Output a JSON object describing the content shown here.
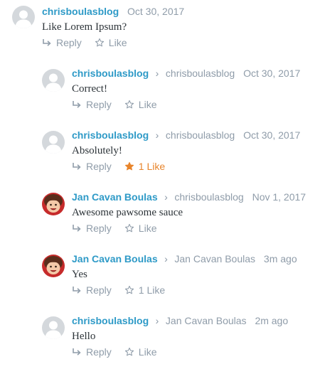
{
  "colors": {
    "author": "#2e9ac7",
    "meta": "#8f9ca9",
    "body_text": "#2c3338",
    "liked": "#e8852c",
    "default_avatar": "#d4d8dc"
  },
  "comments": [
    {
      "author": "chrisboulasblog",
      "reply_to": "",
      "date": "Oct 30, 2017",
      "text": "Like Lorem Ipsum?",
      "reply_label": "Reply",
      "like_label": "Like",
      "liked": false,
      "avatar": "default-avatar-icon"
    },
    {
      "author": "chrisboulasblog",
      "reply_to": "chrisboulasblog",
      "date": "Oct 30, 2017",
      "text": "Correct!",
      "reply_label": "Reply",
      "like_label": "Like",
      "liked": false,
      "avatar": "default-avatar-icon"
    },
    {
      "author": "chrisboulasblog",
      "reply_to": "chrisboulasblog",
      "date": "Oct 30, 2017",
      "text": "Absolutely!",
      "reply_label": "Reply",
      "like_label": "1 Like",
      "liked": true,
      "avatar": "default-avatar-icon"
    },
    {
      "author": "Jan Cavan Boulas",
      "reply_to": "chrisboulasblog",
      "date": "Nov 1, 2017",
      "text": "Awesome pawsome sauce",
      "reply_label": "Reply",
      "like_label": "Like",
      "liked": false,
      "avatar": "cartoon-avatar-icon"
    },
    {
      "author": "Jan Cavan Boulas",
      "reply_to": "Jan Cavan Boulas",
      "date": "3m ago",
      "text": "Yes",
      "reply_label": "Reply",
      "like_label": "1 Like",
      "liked": false,
      "avatar": "cartoon-avatar-icon"
    },
    {
      "author": "chrisboulasblog",
      "reply_to": "Jan Cavan Boulas",
      "date": "2m ago",
      "text": "Hello",
      "reply_label": "Reply",
      "like_label": "Like",
      "liked": false,
      "avatar": "default-avatar-icon"
    }
  ]
}
